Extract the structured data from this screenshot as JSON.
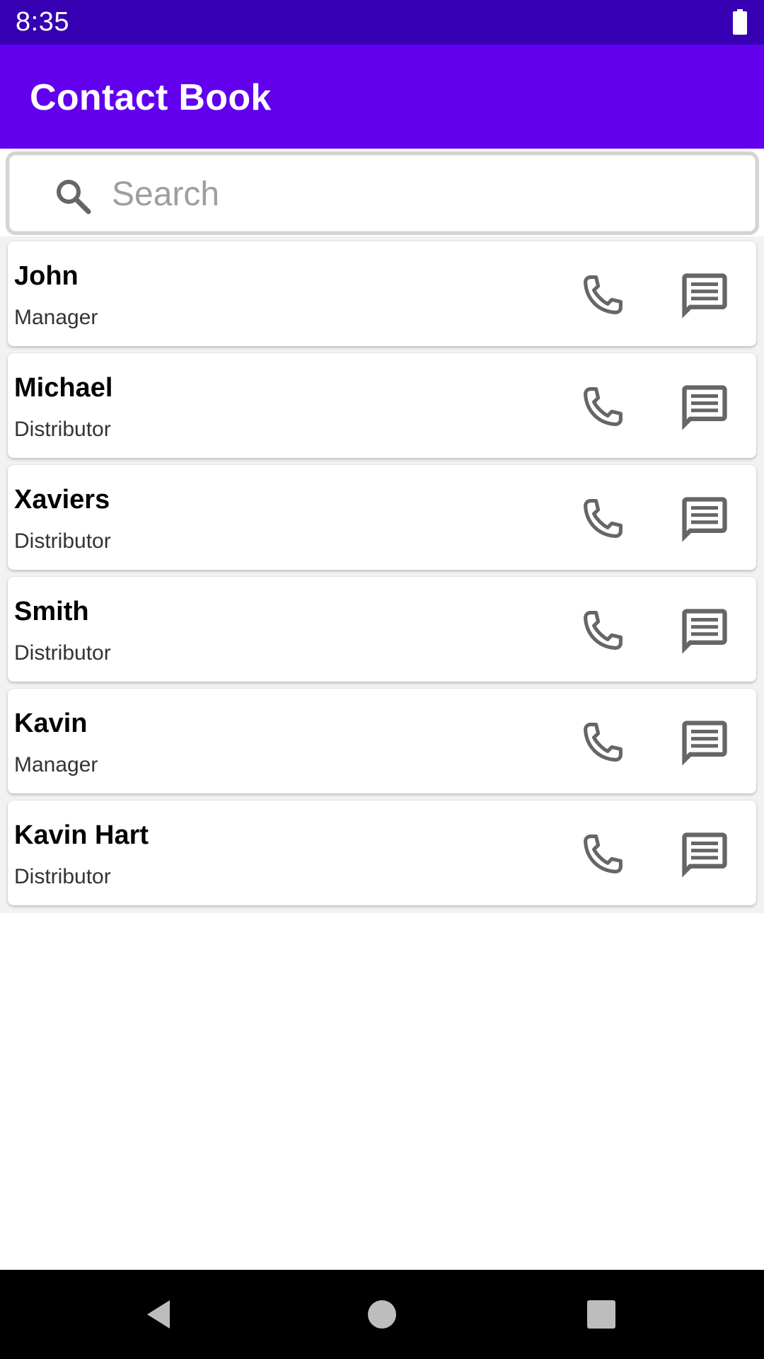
{
  "status_bar": {
    "time": "8:35",
    "battery_icon": "battery-full-icon"
  },
  "app_bar": {
    "title": "Contact Book"
  },
  "search": {
    "icon": "search-icon",
    "placeholder": "Search",
    "value": ""
  },
  "contacts": [
    {
      "name": "John",
      "role": "Manager"
    },
    {
      "name": "Michael",
      "role": "Distributor"
    },
    {
      "name": "Xaviers",
      "role": "Distributor"
    },
    {
      "name": "Smith",
      "role": "Distributor"
    },
    {
      "name": "Kavin",
      "role": "Manager"
    },
    {
      "name": "Kavin Hart",
      "role": "Distributor"
    }
  ],
  "contact_actions": {
    "call_icon": "phone-icon",
    "message_icon": "message-icon"
  },
  "navigation": {
    "back_icon": "back-triangle-icon",
    "home_icon": "home-circle-icon",
    "recents_icon": "recents-square-icon"
  },
  "colors": {
    "status_bar": "#3700b3",
    "app_bar": "#6200ee",
    "icon": "#666666",
    "nav_bar": "#000000"
  }
}
